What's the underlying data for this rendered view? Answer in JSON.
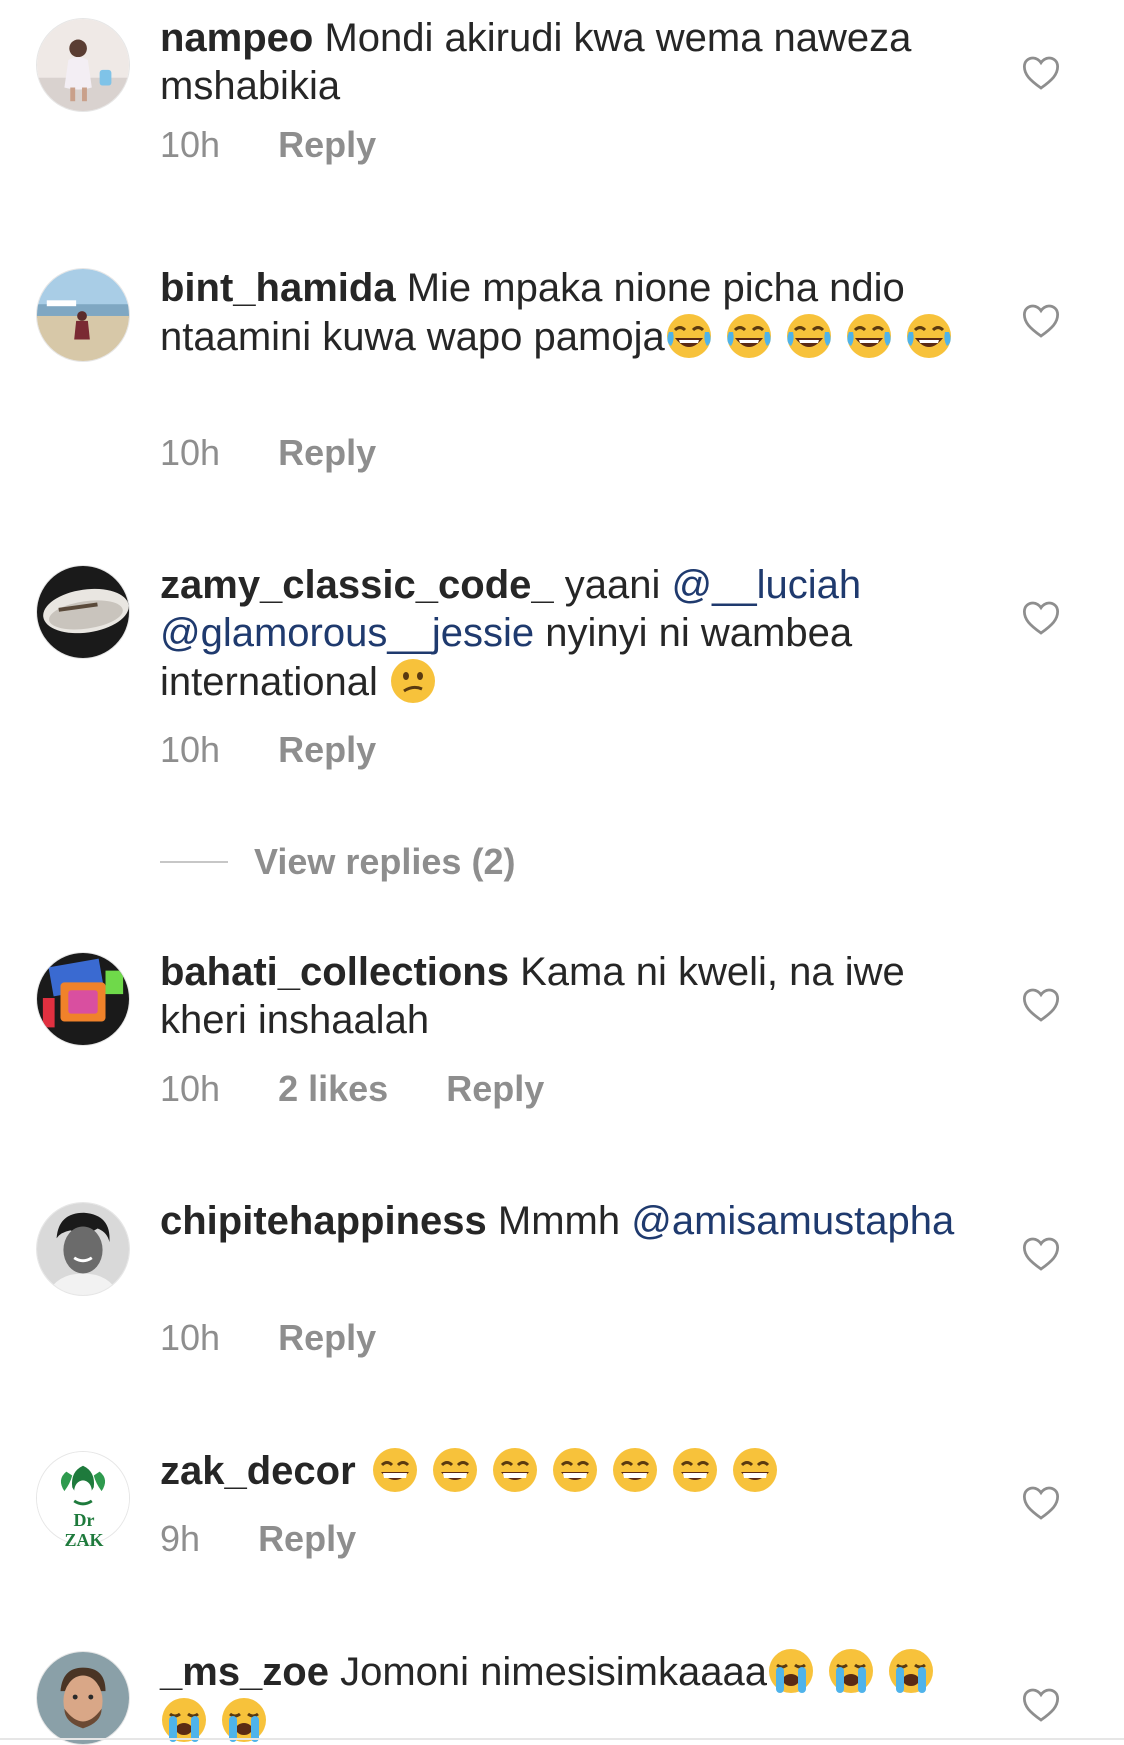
{
  "comments": [
    {
      "username": "nampeo",
      "text": "Mondi akirudi kwa wema naweza mshabikia",
      "time": "10h",
      "likes": "",
      "reply_label": "Reply",
      "avatar_icon": "avatar-child-photo"
    },
    {
      "username": "bint_hamida",
      "text": "Mie mpaka nione picha ndio ntaamini kuwa wapo pamoja",
      "time": "10h",
      "likes": "",
      "reply_label": "Reply",
      "emoji_icon": "tears-of-joy-emoji",
      "emoji_count": 5
    },
    {
      "username": "zamy_classic_code_",
      "text_before": "yaani",
      "mention_1": "@__luciah",
      "mention_2": "@glamorous__jessie",
      "text_after": "nyinyi ni wambea international",
      "time": "10h",
      "likes": "",
      "reply_label": "Reply",
      "emoji_icon": "confused-face-emoji",
      "view_replies_label": "View replies (2)"
    },
    {
      "username": "bahati_collections",
      "text": "Kama ni kweli, na iwe kheri inshaalah",
      "time": "10h",
      "likes": "2 likes",
      "reply_label": "Reply"
    },
    {
      "username": "chipitehappiness",
      "text": "Mmmh",
      "mention_1": "@amisamustapha",
      "time": "10h",
      "likes": "",
      "reply_label": "Reply"
    },
    {
      "username": "zak_decor",
      "text": "",
      "time": "9h",
      "likes": "",
      "reply_label": "Reply",
      "emoji_icon": "grinning-face-emoji",
      "emoji_count": 7,
      "avatar_logo_text": "Dr ZAK"
    },
    {
      "username": "_ms_zoe",
      "text": "Jomoni nimesisimkaaaa",
      "time": "",
      "likes": "",
      "reply_label": "",
      "emoji_icon": "loudly-crying-emoji",
      "emoji_count": 5
    }
  ],
  "icons": {
    "like": "heart-outline-icon"
  },
  "colors": {
    "text": "#262626",
    "meta": "#8e8e8e",
    "mention": "#1f3a6e",
    "emoji_yellow": "#f7c23b"
  }
}
